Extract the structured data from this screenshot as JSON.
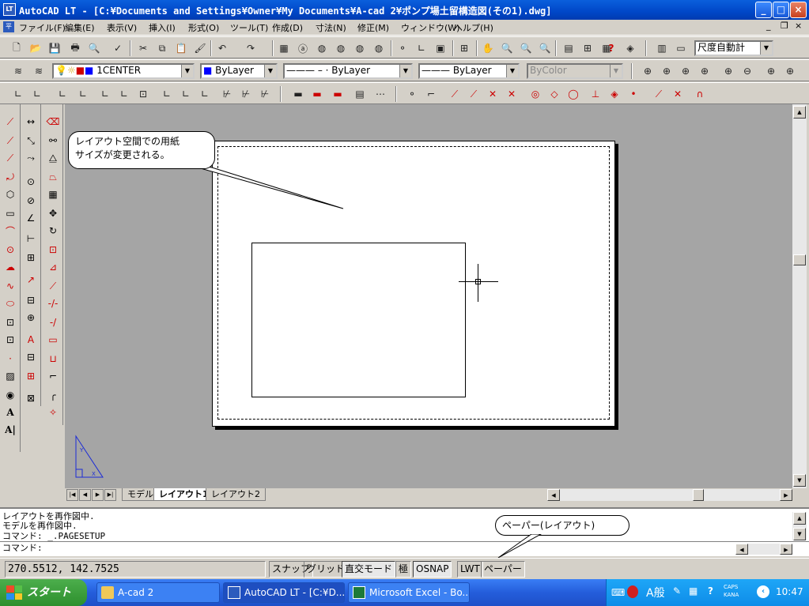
{
  "window": {
    "title": "AutoCAD LT - [C:¥Documents and Settings¥Owner¥My Documents¥A-cad 2¥ポンプ場土留構造図(その1).dwg]",
    "app_icon_text": "LT",
    "minimize": "_",
    "maximize": "□",
    "close": "×",
    "doc_minimize": "_",
    "doc_restore": "❐",
    "doc_close": "×"
  },
  "menu": {
    "items": [
      "ファイル(F)",
      "編集(E)",
      "表示(V)",
      "挿入(I)",
      "形式(O)",
      "ツール(T)",
      "作成(D)",
      "寸法(N)",
      "修正(M)",
      "ウィンドウ(W)",
      "ヘルプ(H)"
    ]
  },
  "properties": {
    "layer": "1CENTER",
    "color": "ByLayer",
    "linetype": "ByLayer",
    "lineweight": "ByLayer",
    "plotstyle": "ByColor",
    "dimstyle": "尺度自動計"
  },
  "callouts": {
    "layout_note_line1": "レイアウト空間での用紙",
    "layout_note_line2": "サイズが変更される。",
    "paper_note": "ペーパー(レイアウト)"
  },
  "layout_tabs": {
    "model": "モデル",
    "layout1": "レイアウト1",
    "layout2": "レイアウト2"
  },
  "command": {
    "lines": [
      "レイアウトを再作図中.",
      "モデルを再作図中.",
      "コマンド: _.PAGESETUP",
      "コマンド:"
    ]
  },
  "status": {
    "coords": "270.5512, 142.7525",
    "snap": "スナップ",
    "grid": "グリッド",
    "ortho": "直交モード",
    "polar": "極",
    "osnap": "OSNAP",
    "lwt": "LWT",
    "paper": "ペーパー"
  },
  "taskbar": {
    "start": "スタート",
    "tasks": [
      "A-cad 2",
      "AutoCAD LT - [C:¥D...",
      "Microsoft Excel - Bo..."
    ],
    "ime": "A般",
    "caps": "CAPS",
    "kana": "KANA",
    "time": "10:47"
  },
  "colors": {
    "title_blue": "#0a5fdc",
    "drawing_bg": "#a5a5a5",
    "taskbar_blue": "#245ddb",
    "start_green": "#3ba03b"
  }
}
